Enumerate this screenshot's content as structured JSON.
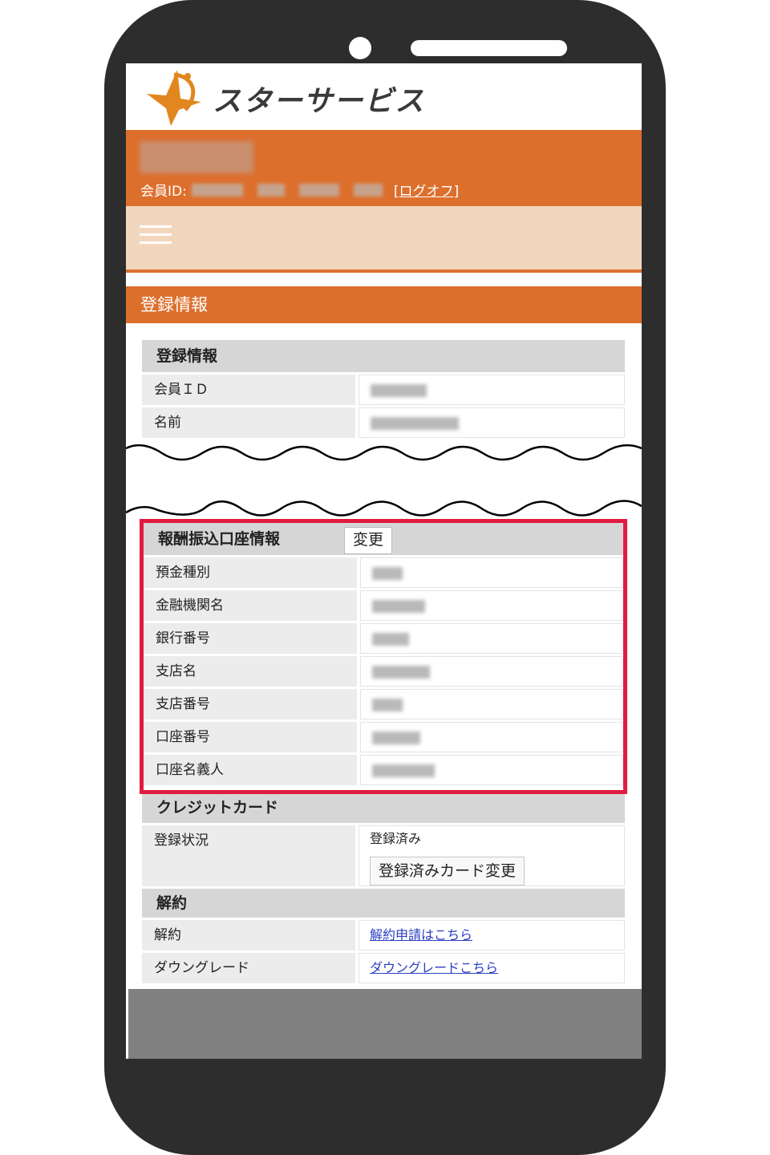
{
  "app": {
    "logo_text": "スターサービス"
  },
  "header": {
    "member_id_label": "会員ID:",
    "logoff_link": "[ログオフ]"
  },
  "section": {
    "title": "登録情報"
  },
  "registration": {
    "header": "登録情報",
    "rows": [
      {
        "label": "会員ＩＤ"
      },
      {
        "label": "名前"
      }
    ]
  },
  "bank": {
    "header": "報酬振込口座情報",
    "change_button": "変更",
    "rows": [
      {
        "label": "預金種別"
      },
      {
        "label": "金融機関名"
      },
      {
        "label": "銀行番号"
      },
      {
        "label": "支店名"
      },
      {
        "label": "支店番号"
      },
      {
        "label": "口座番号"
      },
      {
        "label": "口座名義人"
      }
    ]
  },
  "credit": {
    "header": "クレジットカード",
    "status_label": "登録状況",
    "status_value": "登録済み",
    "change_card_button": "登録済みカード変更"
  },
  "cancel": {
    "header": "解約",
    "rows": [
      {
        "label": "解約",
        "link": "解約申請はこちら"
      },
      {
        "label": "ダウングレード",
        "link": "ダウングレードこちら"
      }
    ]
  },
  "colors": {
    "accent": "#dd6f2d",
    "menu_bg": "#f2d6bc",
    "highlight": "#e01b3f",
    "link": "#2b3fc0"
  }
}
